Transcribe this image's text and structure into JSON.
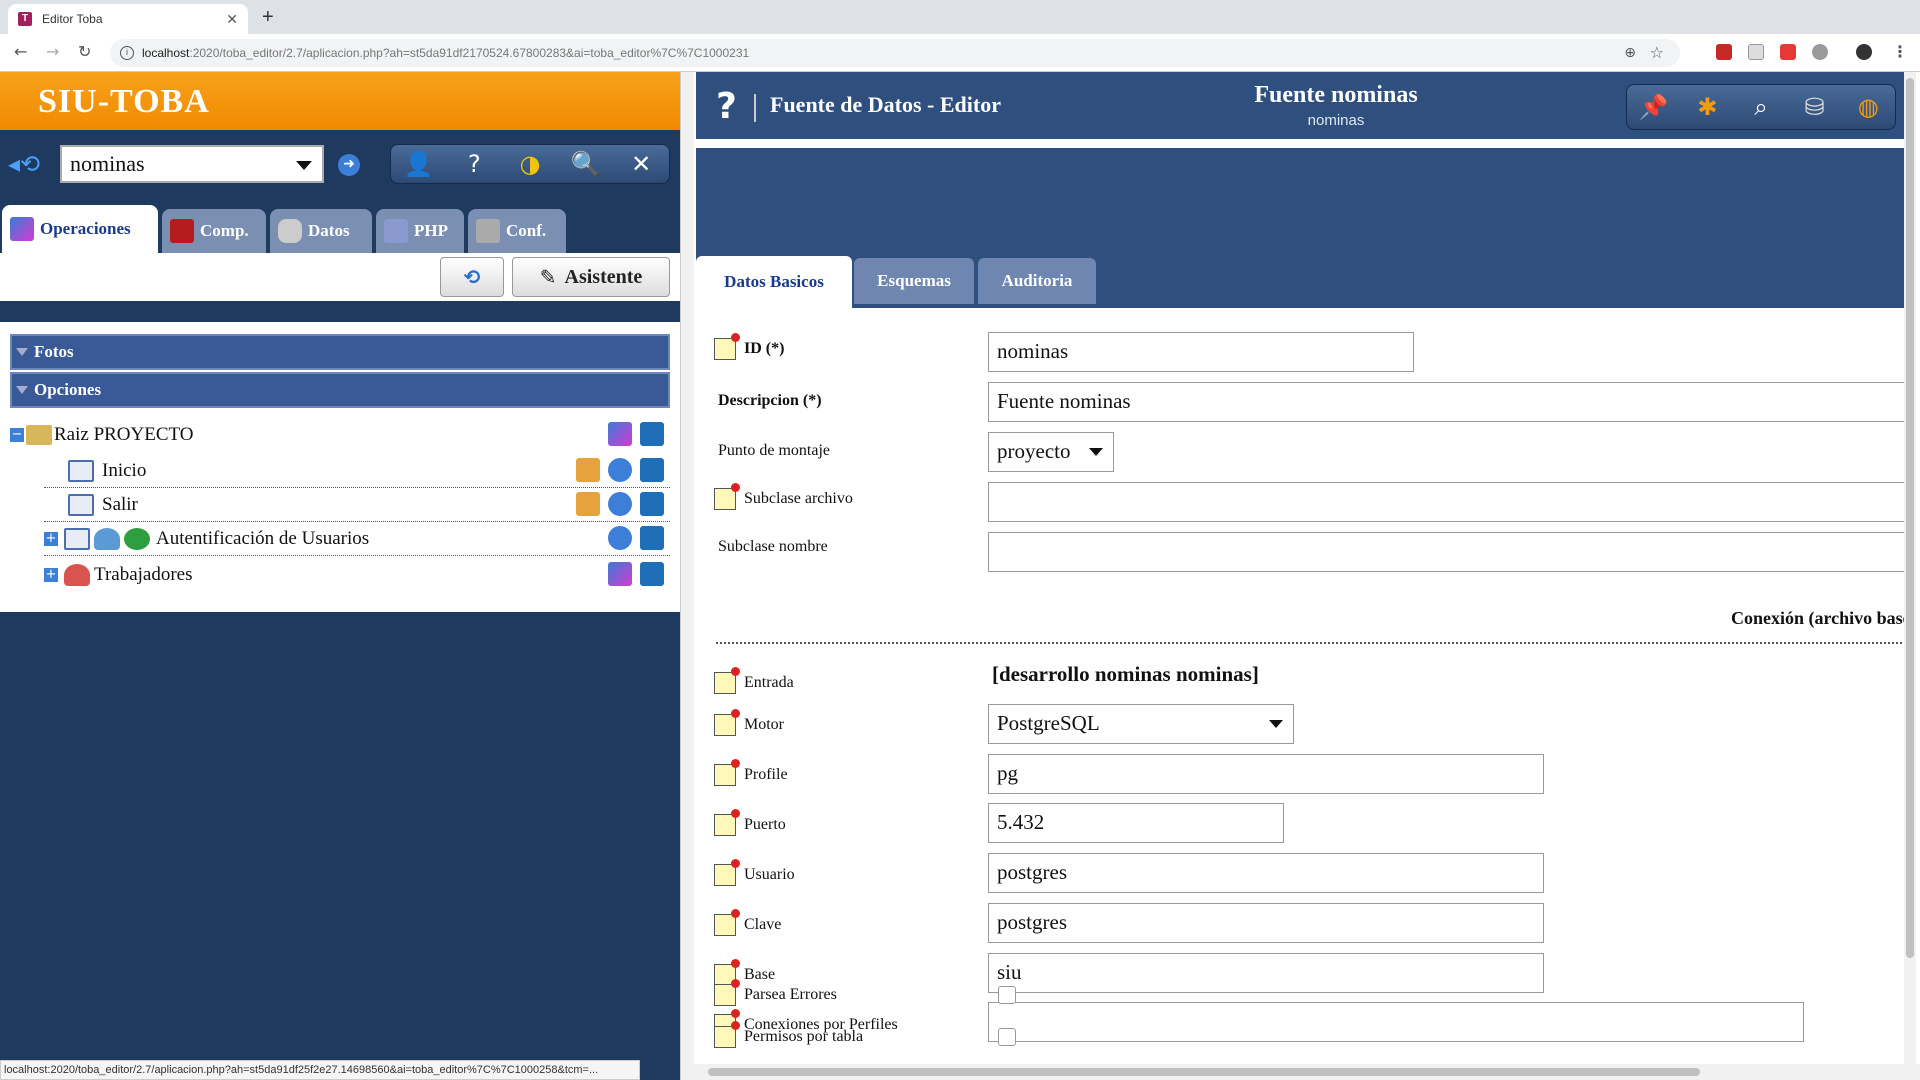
{
  "browser": {
    "tab_title": "Editor Toba",
    "url_host": "localhost",
    "url_path": ":2020/toba_editor/2.7/aplicacion.php?ah=st5da91df2170524.67800283&ai=toba_editor%7C%7C1000231",
    "status_url": "localhost:2020/toba_editor/2.7/aplicacion.php?ah=st5da91df25f2e27.14698560&ai=toba_editor%7C%7C1000258&tcm=..."
  },
  "left": {
    "brand": "SIU-TOBA",
    "project": "nominas",
    "tabs": [
      {
        "label": "Operaciones",
        "icon": "operaciones-icon"
      },
      {
        "label": "Comp.",
        "icon": "componentes-icon"
      },
      {
        "label": "Datos",
        "icon": "database-icon"
      },
      {
        "label": "PHP",
        "icon": "php-icon"
      },
      {
        "label": "Conf.",
        "icon": "wrench-icon"
      }
    ],
    "wizard_label": "Asistente",
    "sections": [
      "Fotos",
      "Opciones"
    ],
    "tree": [
      {
        "label": "Raiz PROYECTO"
      },
      {
        "label": "Inicio"
      },
      {
        "label": "Salir"
      },
      {
        "label": "Autentificación de Usuarios"
      },
      {
        "label": "Trabajadores"
      }
    ]
  },
  "right": {
    "header_title": "Fuente de Datos - Editor",
    "object_title": "Fuente nominas",
    "object_subtitle": "nominas",
    "tabs": [
      "Datos Basicos",
      "Esquemas",
      "Auditoria"
    ],
    "fields": {
      "id_label": "ID (*)",
      "id_value": "nominas",
      "desc_label": "Descripcion (*)",
      "desc_value": "Fuente nominas",
      "montaje_label": "Punto de montaje",
      "montaje_value": "proyecto",
      "subclase_archivo_label": "Subclase archivo",
      "subclase_archivo_value": "",
      "subclase_nombre_label": "Subclase nombre",
      "subclase_nombre_value": "",
      "conexion_title": "Conexión (archivo bases.ini)",
      "entrada_label": "Entrada",
      "entrada_value": "[desarrollo nominas nominas]",
      "motor_label": "Motor",
      "motor_value": "PostgreSQL",
      "profile_label": "Profile",
      "profile_value": "pg",
      "puerto_label": "Puerto",
      "puerto_value": "5.432",
      "usuario_label": "Usuario",
      "usuario_value": "postgres",
      "clave_label": "Clave",
      "clave_value": "postgres",
      "base_label": "Base",
      "base_value": "siu",
      "conexiones_label": "Conexiones por Perfiles",
      "conexiones_value": "",
      "parsea_label": "Parsea Errores",
      "parsea_checked": false,
      "permisos_label": "Permisos por tabla",
      "permisos_checked": false
    }
  }
}
